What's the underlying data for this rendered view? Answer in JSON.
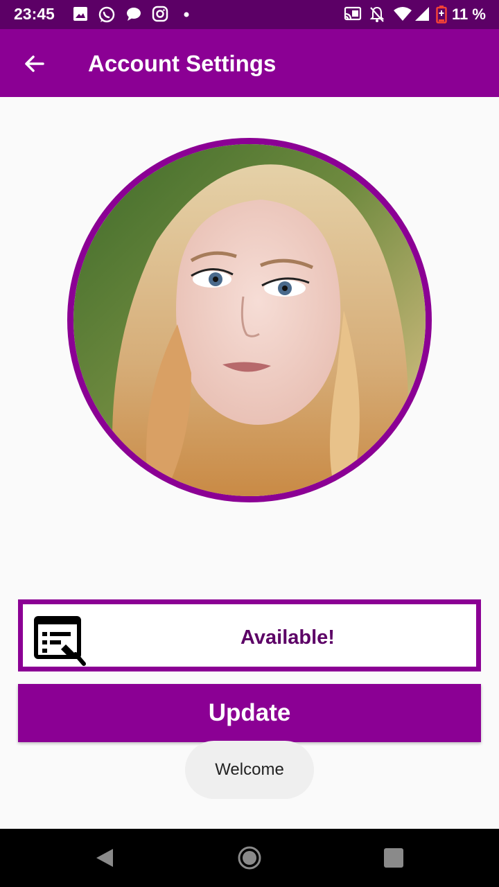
{
  "status_bar": {
    "time": "23:45",
    "battery_percent": "11 %",
    "icons_left": [
      "image-icon",
      "whatsapp-icon",
      "chat-bubble-icon",
      "instagram-icon",
      "dot-icon"
    ],
    "icons_right": [
      "cast-icon",
      "notifications-off-icon",
      "wifi-icon",
      "signal-icon",
      "battery-icon"
    ]
  },
  "app_bar": {
    "title": "Account Settings",
    "back_icon": "arrow-left-icon"
  },
  "profile": {
    "avatar_description": "profile photo"
  },
  "status": {
    "icon": "edit-note-icon",
    "text": "Available!"
  },
  "update_button": {
    "label": "Update"
  },
  "toast": {
    "text": "Welcome"
  },
  "nav_bar": {
    "icons": [
      "back-triangle-icon",
      "home-circle-icon",
      "recents-square-icon"
    ]
  },
  "colors": {
    "primary": "#8b0094",
    "primary_dark": "#5c0066",
    "background": "#fafafa"
  }
}
